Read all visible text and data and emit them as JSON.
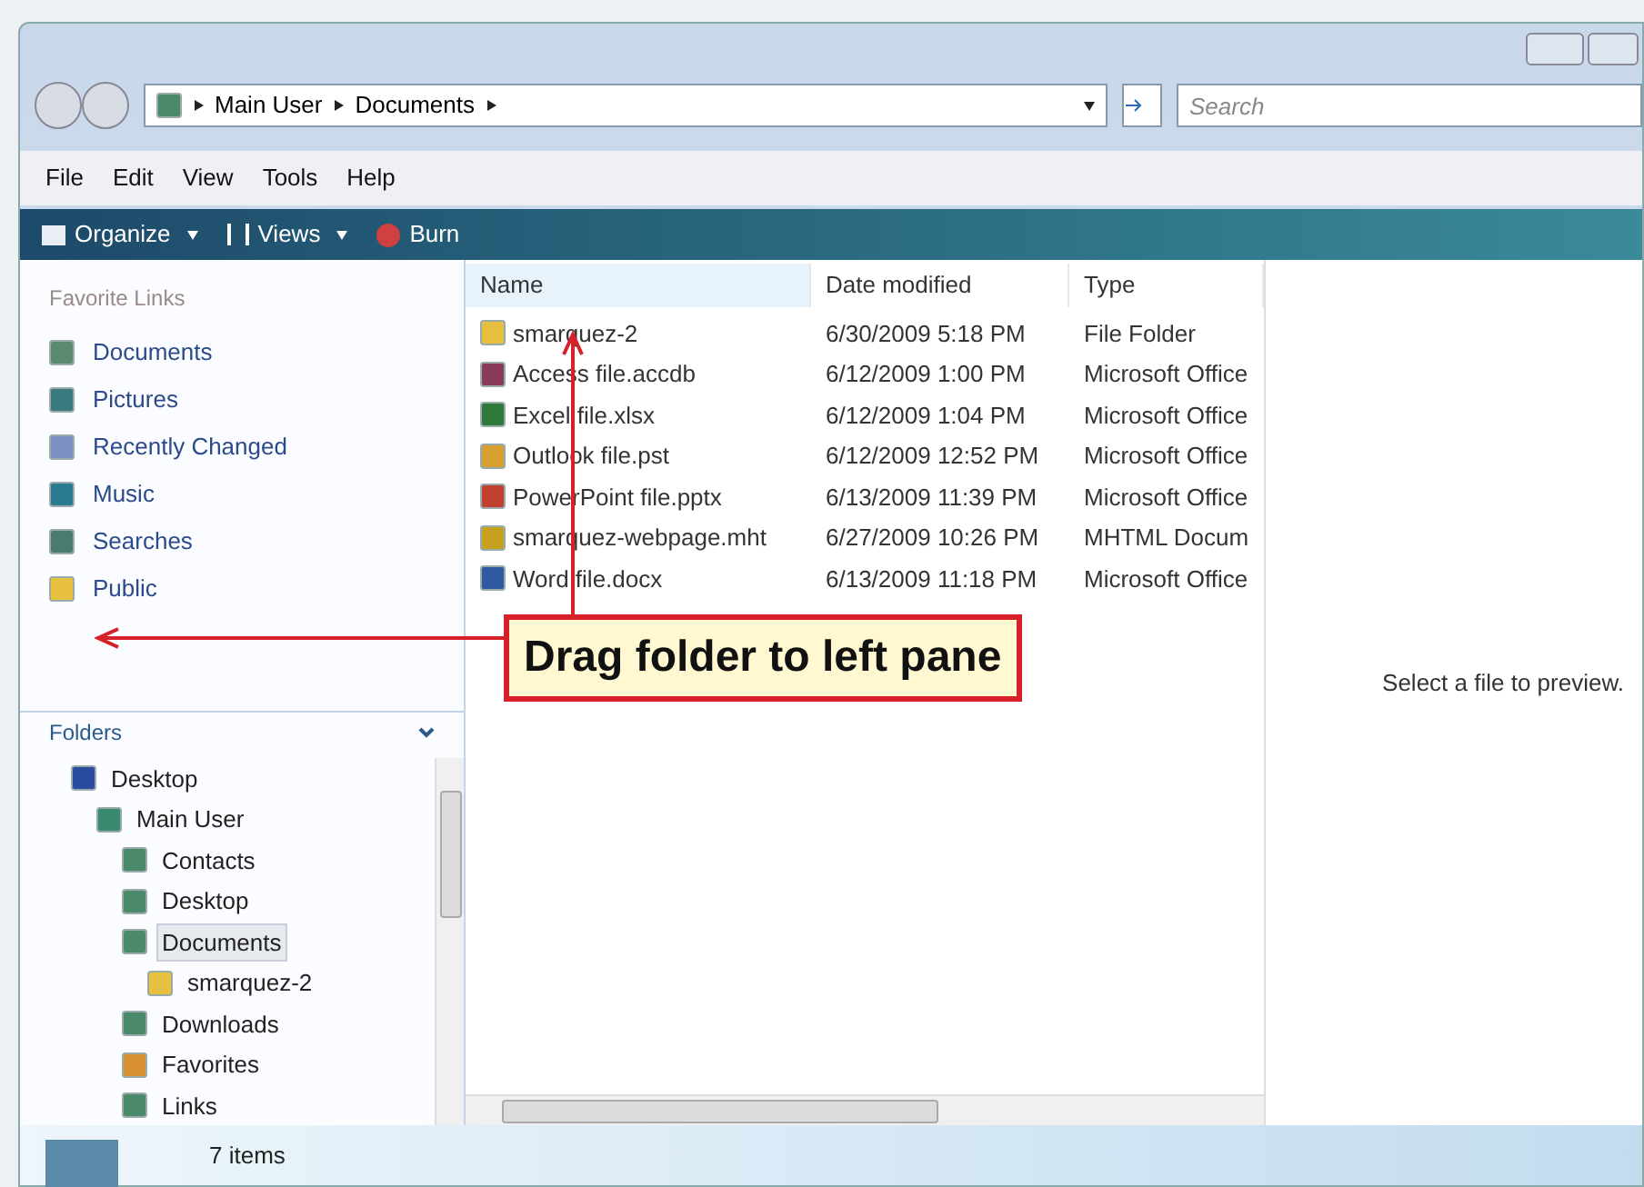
{
  "address": {
    "crumbs": [
      "Main User",
      "Documents"
    ]
  },
  "search": {
    "placeholder": "Search"
  },
  "menu": [
    "File",
    "Edit",
    "View",
    "Tools",
    "Help"
  ],
  "toolbar": [
    {
      "label": "Organize",
      "kind": "organize"
    },
    {
      "label": "Views",
      "kind": "views"
    },
    {
      "label": "Burn",
      "kind": "burn"
    }
  ],
  "favorites": {
    "title": "Favorite Links",
    "items": [
      {
        "label": "Documents",
        "kind": "documents"
      },
      {
        "label": "Pictures",
        "kind": "pictures"
      },
      {
        "label": "Recently Changed",
        "kind": "recent"
      },
      {
        "label": "Music",
        "kind": "music"
      },
      {
        "label": "Searches",
        "kind": "searches"
      },
      {
        "label": "Public",
        "kind": "folder"
      }
    ]
  },
  "folders": {
    "title": "Folders",
    "tree": [
      {
        "label": "Desktop",
        "kind": "desktop",
        "selected": false,
        "children": [
          {
            "label": "Main User",
            "kind": "user",
            "selected": false,
            "children": [
              {
                "label": "Contacts",
                "kind": "library",
                "selected": false
              },
              {
                "label": "Desktop",
                "kind": "library",
                "selected": false
              },
              {
                "label": "Documents",
                "kind": "library",
                "selected": true,
                "children": [
                  {
                    "label": "smarquez-2",
                    "kind": "folder",
                    "selected": false
                  }
                ]
              },
              {
                "label": "Downloads",
                "kind": "library",
                "selected": false
              },
              {
                "label": "Favorites",
                "kind": "favorites",
                "selected": false
              },
              {
                "label": "Links",
                "kind": "library",
                "selected": false
              }
            ]
          }
        ]
      }
    ]
  },
  "table": {
    "columns": [
      "Name",
      "Date modified",
      "Type"
    ],
    "rows": [
      {
        "kind": "folder",
        "name": "smarquez-2",
        "date": "6/30/2009 5:18 PM",
        "type": "File Folder"
      },
      {
        "kind": "access",
        "name": "Access file.accdb",
        "date": "6/12/2009 1:00 PM",
        "type": "Microsoft Office"
      },
      {
        "kind": "excel",
        "name": "Excel file.xlsx",
        "date": "6/12/2009 1:04 PM",
        "type": "Microsoft Office"
      },
      {
        "kind": "outlook",
        "name": "Outlook file.pst",
        "date": "6/12/2009 12:52 PM",
        "type": "Microsoft Office"
      },
      {
        "kind": "powerpoint",
        "name": "PowerPoint file.pptx",
        "date": "6/13/2009 11:39 PM",
        "type": "Microsoft Office"
      },
      {
        "kind": "webpage",
        "name": "smarquez-webpage.mht",
        "date": "6/27/2009 10:26 PM",
        "type": "MHTML Docum"
      },
      {
        "kind": "word",
        "name": "Word file.docx",
        "date": "6/13/2009 11:18 PM",
        "type": "Microsoft Office"
      }
    ]
  },
  "preview": {
    "text": "Select a file to preview."
  },
  "status_bar": {
    "text": "7 items"
  },
  "callout": {
    "text": "Drag folder to left pane"
  }
}
